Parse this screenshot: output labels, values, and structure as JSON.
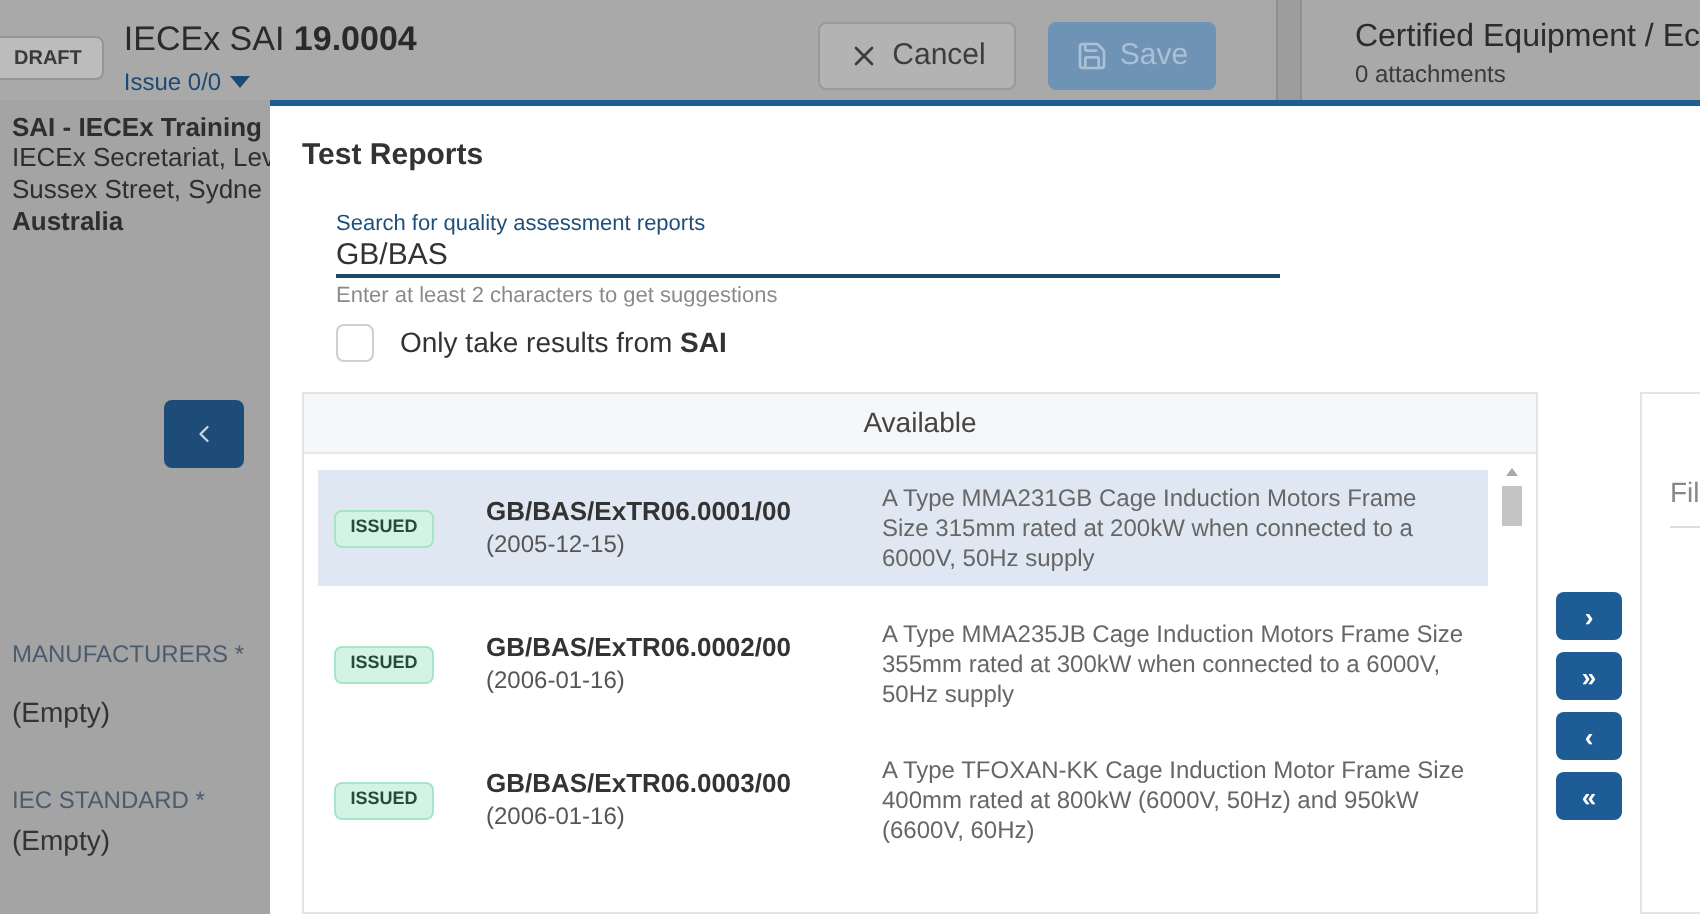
{
  "header": {
    "status_badge": "DRAFT",
    "title": "IECEx SAI **19.0004**",
    "issue": "Issue 0/0",
    "buttons": [
      {
        "label": "Cancel",
        "kind": "cancel",
        "disabled": false
      },
      {
        "label": "Save",
        "kind": "save",
        "disabled": true
      }
    ]
  },
  "attachments_panel": {
    "title": "Certified Equipment / Ec",
    "subtitle": "0 attachments"
  },
  "left_panel": {
    "organisation": "SAI - IECEx Training",
    "address_lines": [
      "IECEx Secretariat, Lev",
      "Sussex Street, Sydne"
    ],
    "country": "Australia",
    "fields": [
      {
        "label": "MANUFACTURERS *",
        "value": "(Empty)"
      },
      {
        "label": "IEC STANDARD *",
        "value": "(Empty)"
      }
    ]
  },
  "dialog": {
    "title": "Test Reports",
    "search": {
      "label": "Search for quality assessment reports",
      "value": "GB/BAS",
      "hint": "Enter at least 2 characters to get suggestions"
    },
    "checkbox": {
      "label": "Only take results from **SAI**",
      "checked": false
    },
    "available": {
      "title": "Available",
      "rows": [
        {
          "status": "ISSUED",
          "code": "GB/BAS/ExTR06.0001/00",
          "date": "(2005-12-15)",
          "description": "A Type MMA231GB Cage Induction Motors Frame Size 315mm rated at 200kW when connected to a 6000V, 50Hz supply",
          "selected": true
        },
        {
          "status": "ISSUED",
          "code": "GB/BAS/ExTR06.0002/00",
          "date": "(2006-01-16)",
          "description": "A Type MMA235JB Cage Induction Motors Frame Size 355mm rated at 300kW when connected to a 6000V, 50Hz supply",
          "selected": false
        },
        {
          "status": "ISSUED",
          "code": "GB/BAS/ExTR06.0003/00",
          "date": "(2006-01-16)",
          "description": "A Type TFOXAN-KK Cage Induction Motor Frame Size 400mm rated at 800kW (6000V, 50Hz) and 950kW (6600V, 60Hz)",
          "selected": false
        }
      ]
    },
    "transfer_buttons": [
      "›",
      "»",
      "‹",
      "«"
    ],
    "selected_panel": {
      "placeholder": "Fil"
    }
  }
}
